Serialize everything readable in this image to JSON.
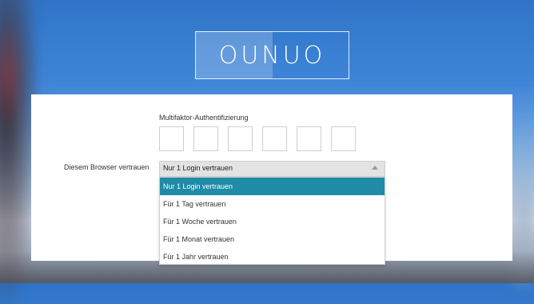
{
  "brand": {
    "logo_text": "OUNUO"
  },
  "mfa": {
    "label": "Multifaktor-Authentifizierung",
    "digit_count": 6
  },
  "trust": {
    "label": "Diesem Browser vertrauen",
    "selected": "Nur 1 Login vertrauen",
    "options": [
      "Nur 1 Login vertrauen",
      "Für 1 Tag vertrauen",
      "Für 1 Woche vertrauen",
      "Für 1 Monat vertrauen",
      "Für 1 Jahr vertrauen"
    ]
  },
  "colors": {
    "accent": "#1f8ba6",
    "background_top": "#2f74c8",
    "panel": "#ffffff"
  }
}
